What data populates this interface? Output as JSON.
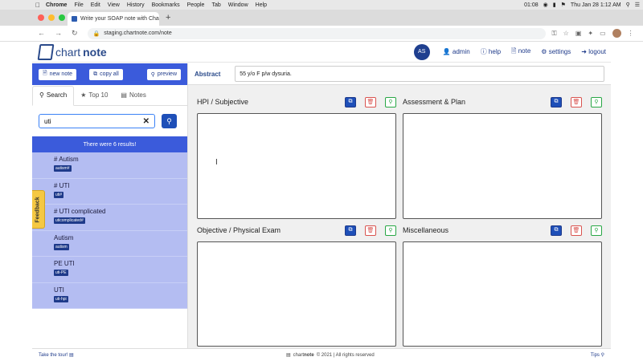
{
  "menubar": {
    "items": [
      "Chrome",
      "File",
      "Edit",
      "View",
      "History",
      "Bookmarks",
      "People",
      "Tab",
      "Window",
      "Help"
    ],
    "time": "01:08",
    "clock": "Thu Jan 28  1:12 AM"
  },
  "browser": {
    "tab_title": "Write your SOAP note with Cha",
    "url": "staging.chartnote.com/note",
    "traffic_colors": [
      "#ff5f57",
      "#febc2e",
      "#28c840"
    ]
  },
  "app": {
    "logo_light": "chart",
    "logo_bold": "note",
    "user_initials": "AS",
    "nav": {
      "admin": "admin",
      "help": "help",
      "note": "note",
      "settings": "settings",
      "logout": "logout"
    },
    "accent": "#3b5bdb",
    "primary": "#1e3a8a"
  },
  "sidebar": {
    "buttons": {
      "new_note": "new note",
      "copy_all": "copy all",
      "preview": "preview"
    },
    "tabs": {
      "search": "Search",
      "top10": "Top 10",
      "notes": "Notes"
    },
    "search_value": "uti",
    "results_header": "There were 6 results!",
    "results": [
      {
        "title": "# Autism",
        "tag": "autism#"
      },
      {
        "title": "# UTI",
        "tag": "uti#"
      },
      {
        "title": "# UTI complicated",
        "tag": "uticomplicated#"
      },
      {
        "title": "Autism",
        "tag": "autism"
      },
      {
        "title": "PE UTI",
        "tag": "uti-PE"
      },
      {
        "title": "UTI",
        "tag": "uti-hpi"
      }
    ],
    "feedback": "Feedback"
  },
  "main": {
    "abstract_label": "Abstract",
    "abstract_value": "55 y/o F p/w dysuria.",
    "panels": {
      "hpi": "HPI / Subjective",
      "assessment": "Assessment & Plan",
      "objective": "Objective / Physical Exam",
      "misc": "Miscellaneous"
    }
  },
  "footer": {
    "tour": "Take the tour!",
    "copyright": "© 2021 | All rights reserved",
    "tips": "Tips"
  }
}
